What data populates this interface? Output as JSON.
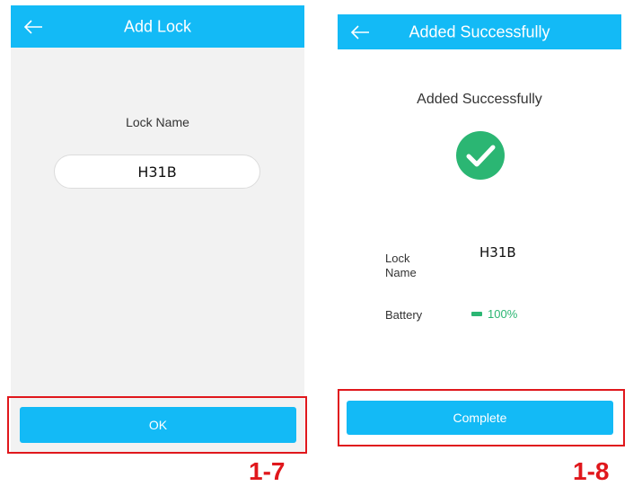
{
  "add_lock_screen": {
    "title": "Add Lock",
    "back_icon": "arrow-left-icon",
    "lock_name_label": "Lock Name",
    "lock_name_value": "H31B",
    "ok_label": "OK"
  },
  "success_screen": {
    "title": "Added Successfully",
    "back_icon": "arrow-left-icon",
    "heading": "Added Successfully",
    "success_icon": "check-circle-icon",
    "lock_name_label": "Lock\nName",
    "lock_name_value": "H31B",
    "battery_label": "Battery",
    "battery_icon": "battery-icon",
    "battery_value": "100%",
    "complete_label": "Complete"
  },
  "annotations": {
    "left_step": "1-7",
    "right_step": "1-8"
  },
  "colors": {
    "accent": "#13baf6",
    "success": "#2bb673",
    "annotation_red": "#e0171c"
  }
}
